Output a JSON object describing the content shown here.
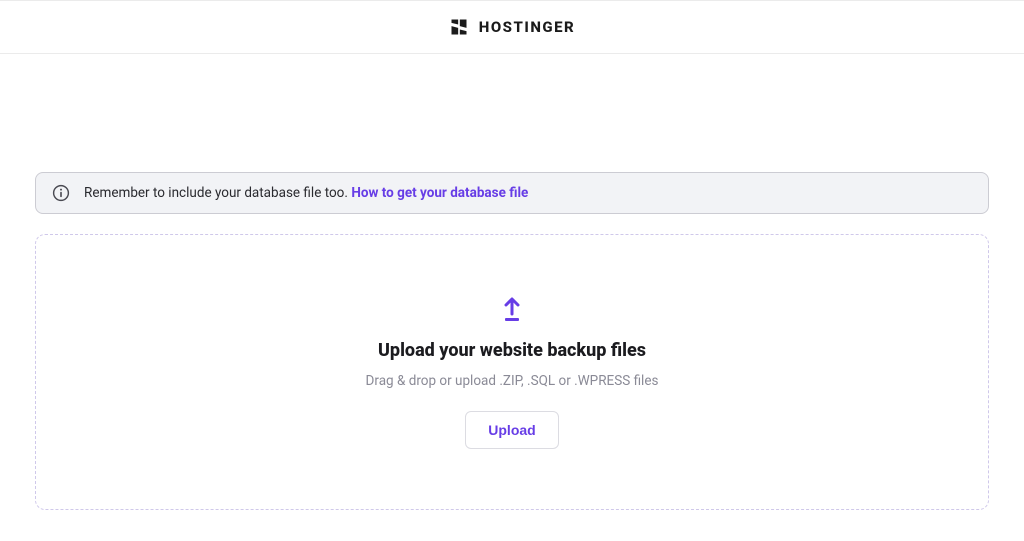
{
  "header": {
    "brand_name": "HOSTINGER"
  },
  "banner": {
    "text": "Remember to include your database file too.",
    "link_text": "How to get your database file"
  },
  "dropzone": {
    "title": "Upload your website backup files",
    "subtitle": "Drag & drop or upload .ZIP, .SQL or .WPRESS files",
    "button_label": "Upload"
  },
  "colors": {
    "accent": "#673de6"
  }
}
